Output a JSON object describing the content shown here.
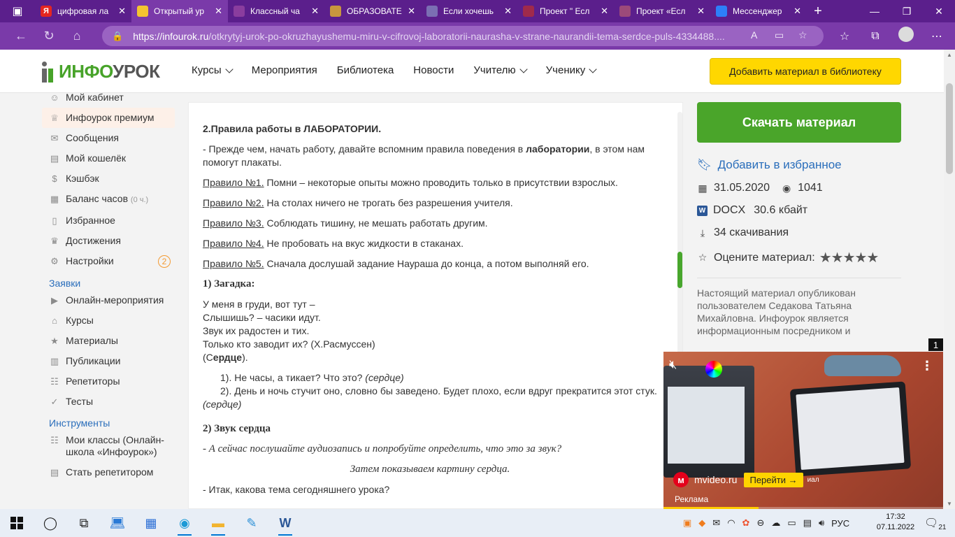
{
  "browser": {
    "tabs": [
      {
        "title": "цифровая ла",
        "favicon_color": "#e52620",
        "favicon_text": "Я",
        "active": false
      },
      {
        "title": "Открытый ур",
        "favicon_color": "#f4c430",
        "favicon_text": "",
        "active": true
      },
      {
        "title": "Классный ча",
        "favicon_color": "#8a3d9e",
        "favicon_text": "",
        "active": false
      },
      {
        "title": "ОБРАЗОВАТЕ",
        "favicon_color": "#c8963e",
        "favicon_text": "",
        "active": false
      },
      {
        "title": "Если хочешь",
        "favicon_color": "#7b6fb3",
        "favicon_text": "",
        "active": false
      },
      {
        "title": "Проект \" Есл",
        "favicon_color": "#a02a4b",
        "favicon_text": "",
        "active": false
      },
      {
        "title": "Проект «Есл",
        "favicon_color": "#9c4a7a",
        "favicon_text": "",
        "active": false
      },
      {
        "title": "Мессенджер",
        "favicon_color": "#2d7ff9",
        "favicon_text": "",
        "active": false
      }
    ],
    "url_domain": "https://infourok.ru",
    "url_path": "/otkrytyj-urok-po-okruzhayushemu-miru-v-cifrovoj-laboratorii-naurasha-v-strane-naurandii-tema-serdce-puls-4334488...."
  },
  "site": {
    "logo_g": "ИНФО",
    "logo_d": "УРОК",
    "nav": [
      "Курсы",
      "Мероприятия",
      "Библиотека",
      "Новости",
      "Учителю",
      "Ученику"
    ],
    "add_button": "Добавить материал в библиотеку"
  },
  "sidebar": {
    "items1": [
      {
        "label": "Мой кабинет",
        "icon": "☺"
      },
      {
        "label": "Инфоурок премиум",
        "icon": "♕"
      },
      {
        "label": "Сообщения",
        "icon": "✉"
      },
      {
        "label": "Мой кошелёк",
        "icon": "▤"
      },
      {
        "label": "Кэшбэк",
        "icon": "$"
      },
      {
        "label": "Баланс часов",
        "icon": "▦",
        "suffix": "(0 ч.)"
      },
      {
        "label": "Избранное",
        "icon": "▯"
      },
      {
        "label": "Достижения",
        "icon": "♛"
      },
      {
        "label": "Настройки",
        "icon": "⚙",
        "badge": "2"
      }
    ],
    "section2": "Заявки",
    "items2": [
      {
        "label": "Онлайн-мероприятия",
        "icon": "▶"
      },
      {
        "label": "Курсы",
        "icon": "⌂"
      },
      {
        "label": "Материалы",
        "icon": "★"
      },
      {
        "label": "Публикации",
        "icon": "▥"
      },
      {
        "label": "Репетиторы",
        "icon": "☷"
      },
      {
        "label": "Тесты",
        "icon": "✓"
      }
    ],
    "section3": "Инструменты",
    "items3": [
      {
        "label": "Мои классы (Онлайн-школа «Инфоурок»)",
        "icon": "☷"
      },
      {
        "label": "Стать репетитором",
        "icon": "▤"
      }
    ]
  },
  "content": {
    "heading": "2.Правила работы в ЛАБОРАТОРИИ.",
    "intro_a": "- Прежде чем, начать работу, давайте вспомним правила поведения в ",
    "intro_b": "лаборатории",
    "intro_c": ", в этом нам помогут плакаты.",
    "rules": [
      {
        "label": "Правило №1.",
        "text": " Помни – некоторые опыты можно проводить только в присутствии взрослых."
      },
      {
        "label": "Правило №2.",
        "text": " На столах ничего не трогать без разрешения учителя."
      },
      {
        "label": "Правило №3.",
        "text": " Соблюдать тишину, не мешать работать другим."
      },
      {
        "label": "Правило №4.",
        "text": " Не пробовать на вкус жидкости в стаканах."
      },
      {
        "label": "Правило №5.",
        "text": " Сначала дослушай задание Наураша до конца, а потом выполняй его."
      }
    ],
    "riddle_head": "1)    Загадка:",
    "riddle_lines": [
      "У меня в груди, вот тут –",
      "Слышишь? – часики идут.",
      "Звук их радостен и тих.",
      "Только кто заводит их?   (Х.Расмуссен)"
    ],
    "answer_a": "(С",
    "answer_b": "ердце",
    "answer_c": ").",
    "q1_text": "1). Не часы, а тикает? Что это? ",
    "q1_ans": "(сердце)",
    "q2_text": "2). День и ночь стучит оно, словно бы заведено. Будет плохо, если вдруг прекратится этот стук.  ",
    "q2_ans": "(сердце)",
    "sound_head": "2)    Звук сердца",
    "listen": "- А сейчас послушайте аудиозапись и попробуйте определить, что это за звук?",
    "show": "Затем показываем картину сердца.",
    "question": "- Итак, какова тема сегодняшнего урока?"
  },
  "right": {
    "download": "Скачать материал",
    "favorite": "Добавить в избранное",
    "date": "31.05.2020",
    "views": "1041",
    "format": "DOCX",
    "size": "30.6 кбайт",
    "downloads": "34 скачивания",
    "rate": "Оцените материал:",
    "disclaimer": "Настоящий материал опубликован пользователем Седакова Татьяна Михайловна. Инфоурок является информационным посредником и предоставляет пользователям"
  },
  "ad": {
    "counter": "1",
    "site": "mvideo.ru",
    "go": "Перейти →",
    "tail": "иал",
    "label": "Реклама",
    "progress": 0.34
  },
  "taskbar": {
    "lang": "РУС",
    "time": "17:32",
    "date": "07.11.2022",
    "notifications": "21"
  }
}
